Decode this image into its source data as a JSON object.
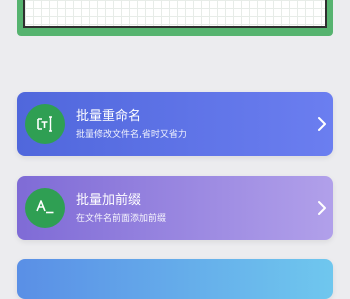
{
  "tools": [
    {
      "title": "批量重命名",
      "subtitle": "批量修改文件名,省时又省力",
      "icon": "rename-icon"
    },
    {
      "title": "批量加前缀",
      "subtitle": "在文件名前面添加前缀",
      "icon": "add-prefix-icon"
    }
  ],
  "colors": {
    "icon_bg": "#2f9f53",
    "banner_green": "#56b36f",
    "card1": [
      "#5067dc",
      "#6b7ef0"
    ],
    "card2": [
      "#7f6bd6",
      "#b1a0ea"
    ],
    "card3": [
      "#5a8fe6",
      "#6fc7ee"
    ]
  }
}
